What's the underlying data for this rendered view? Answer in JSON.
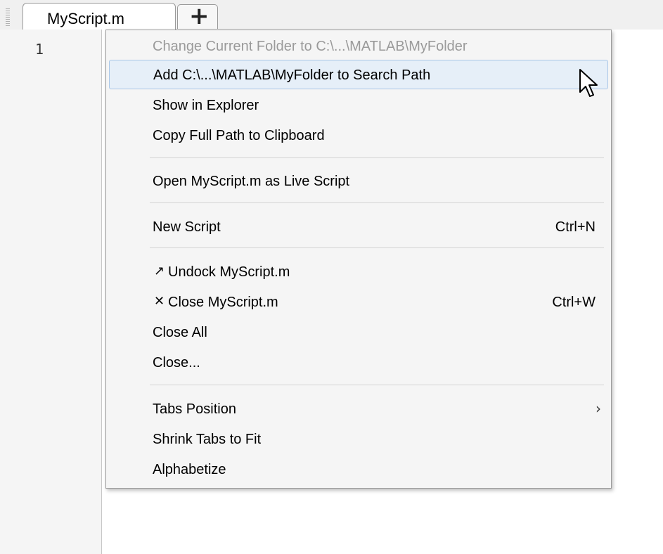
{
  "tab": {
    "title": "MyScript.m",
    "close_glyph": "✕",
    "new_tab_glyph": "+"
  },
  "editor": {
    "line_numbers": [
      "1"
    ]
  },
  "context_menu": {
    "items": [
      {
        "label": "Change Current Folder to C:\\...\\MATLAB\\MyFolder",
        "disabled": true
      },
      {
        "label": "Add C:\\...\\MATLAB\\MyFolder to Search Path",
        "hover": true
      },
      {
        "label": "Show in Explorer"
      },
      {
        "label": "Copy Full Path to Clipboard"
      },
      {
        "label": "Open MyScript.m as Live Script"
      },
      {
        "label": "New Script",
        "shortcut": "Ctrl+N"
      },
      {
        "label": "Undock MyScript.m",
        "icon": "undock-icon",
        "icon_glyph": "↗"
      },
      {
        "label": "Close MyScript.m",
        "shortcut": "Ctrl+W",
        "icon": "close-icon",
        "icon_glyph": "✕"
      },
      {
        "label": "Close All"
      },
      {
        "label": "Close..."
      },
      {
        "label": "Tabs Position",
        "submenu_glyph": "›"
      },
      {
        "label": "Shrink Tabs to Fit"
      },
      {
        "label": "Alphabetize"
      }
    ]
  },
  "colors": {
    "menu_background": "#f5f5f5",
    "hover_background": "#e6eff8",
    "hover_border": "#a9c6e6",
    "disabled_text": "#9a9a9a"
  }
}
